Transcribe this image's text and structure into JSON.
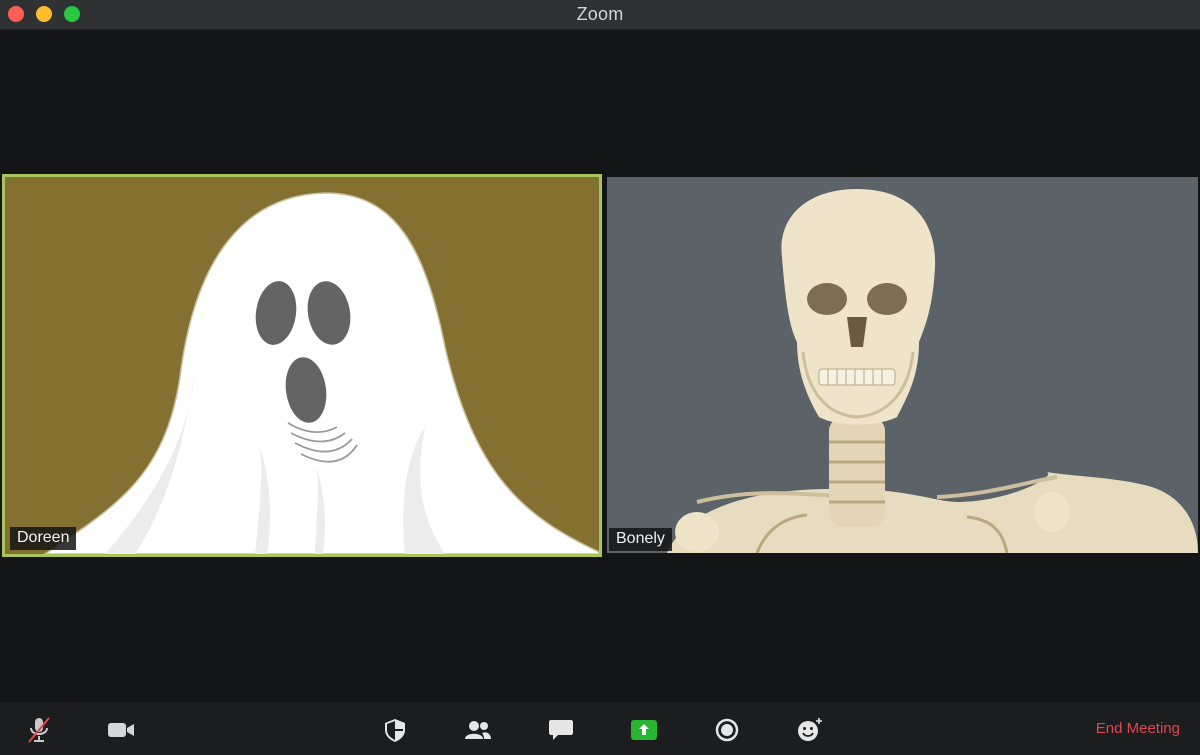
{
  "window": {
    "title": "Zoom"
  },
  "participants": [
    {
      "name": "Doreen",
      "active_speaker": true,
      "video": "ghost-illustration"
    },
    {
      "name": "Bonely",
      "active_speaker": false,
      "video": "skeleton-photo"
    }
  ],
  "toolbar": {
    "buttons": [
      {
        "id": "mute",
        "icon": "microphone-muted-icon"
      },
      {
        "id": "video",
        "icon": "video-camera-icon"
      },
      {
        "id": "security",
        "icon": "shield-icon"
      },
      {
        "id": "participants",
        "icon": "participants-icon"
      },
      {
        "id": "chat",
        "icon": "chat-bubble-icon"
      },
      {
        "id": "share",
        "icon": "share-screen-icon"
      },
      {
        "id": "record",
        "icon": "record-icon"
      },
      {
        "id": "reactions",
        "icon": "reaction-smiley-icon"
      }
    ],
    "end_label": "End Meeting"
  },
  "colors": {
    "active_speaker_border": "#a9c55a",
    "share_green": "#27b532",
    "end_red": "#e0484f"
  }
}
